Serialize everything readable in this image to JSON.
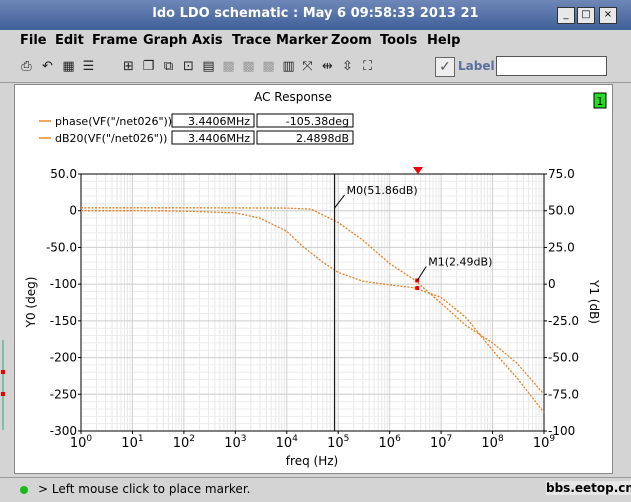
{
  "window": {
    "title": "ldo LDO schematic : May  6 09:58:33 2013 21",
    "minimize": "_",
    "maximize": "□",
    "close": "×"
  },
  "menu": [
    "File",
    "Edit",
    "Frame",
    "Graph",
    "Axis",
    "Trace",
    "Marker",
    "Zoom",
    "Tools",
    "Help"
  ],
  "toolbar": {
    "icons": [
      "print-icon",
      "undo-icon",
      "grid-icon",
      "strip-icon",
      "add-subwindow-icon",
      "copy-window-icon",
      "delete-window-icon",
      "layout-icon",
      "card-icon",
      "card-gray-icon",
      "card-gray2-icon",
      "calculator-icon",
      "fit-icon",
      "zoom-x-icon",
      "zoom-y-icon",
      "zoom-box-icon"
    ],
    "label_text": "Label",
    "label_value": ""
  },
  "plot": {
    "title": "AC Response",
    "subwin_badge": "1",
    "legend": [
      {
        "name": "phase(VF(\"/net026\"))",
        "x": "3.4406MHz",
        "y": "-105.38deg",
        "color": "#ee8822"
      },
      {
        "name": "dB20(VF(\"/net026\"))",
        "x": "3.4406MHz",
        "y": "2.4898dB",
        "color": "#ee8822"
      }
    ],
    "markers": [
      {
        "label": "M0(51.86dB)",
        "x": 85000
      },
      {
        "label": "M1(2.49dB)",
        "x": 3440600
      }
    ]
  },
  "chart_data": {
    "type": "line",
    "xlabel": "freq (Hz)",
    "ylabel_left": "Y0 (deg)",
    "ylabel_right": "Y1 (dB)",
    "xscale": "log",
    "xlim": [
      1,
      1000000000
    ],
    "ylim_left": [
      -300,
      50
    ],
    "ylim_right": [
      -100,
      75
    ],
    "xticks": [
      "10^0",
      "10^1",
      "10^2",
      "10^3",
      "10^4",
      "10^5",
      "10^6",
      "10^7",
      "10^8",
      "10^9"
    ],
    "yticks_left": [
      "50.0",
      "0",
      "-50.0",
      "-100",
      "-150",
      "-200",
      "-250",
      "-300"
    ],
    "yticks_right": [
      "75.0",
      "50.0",
      "25.0",
      "0",
      "-25.0",
      "-50.0",
      "-75.0",
      "-100"
    ],
    "grid": true,
    "series": [
      {
        "name": "phase(VF(\"/net026\"))",
        "axis": "left",
        "x": [
          1,
          10,
          100,
          1000,
          3000,
          10000,
          20000,
          50000,
          100000,
          300000,
          1000000,
          3000000,
          10000000,
          30000000,
          100000000,
          300000000,
          1000000000
        ],
        "y": [
          0,
          0,
          -0.5,
          -3,
          -10,
          -28,
          -48,
          -70,
          -84,
          -96,
          -101,
          -105,
          -118,
          -145,
          -190,
          -228,
          -275
        ]
      },
      {
        "name": "dB20(VF(\"/net026\"))",
        "axis": "right",
        "x": [
          1,
          10,
          100,
          1000,
          10000,
          30000,
          100000,
          300000,
          1000000,
          3000000,
          10000000,
          30000000,
          100000000,
          300000000,
          1000000000
        ],
        "y": [
          52,
          52,
          52,
          51.9,
          51.8,
          51,
          42,
          30,
          14,
          3,
          -13,
          -28,
          -40,
          -54,
          -75
        ]
      }
    ]
  },
  "status": {
    "text": "> Left mouse click to place marker."
  },
  "watermark": "bbs.eetop.cn"
}
